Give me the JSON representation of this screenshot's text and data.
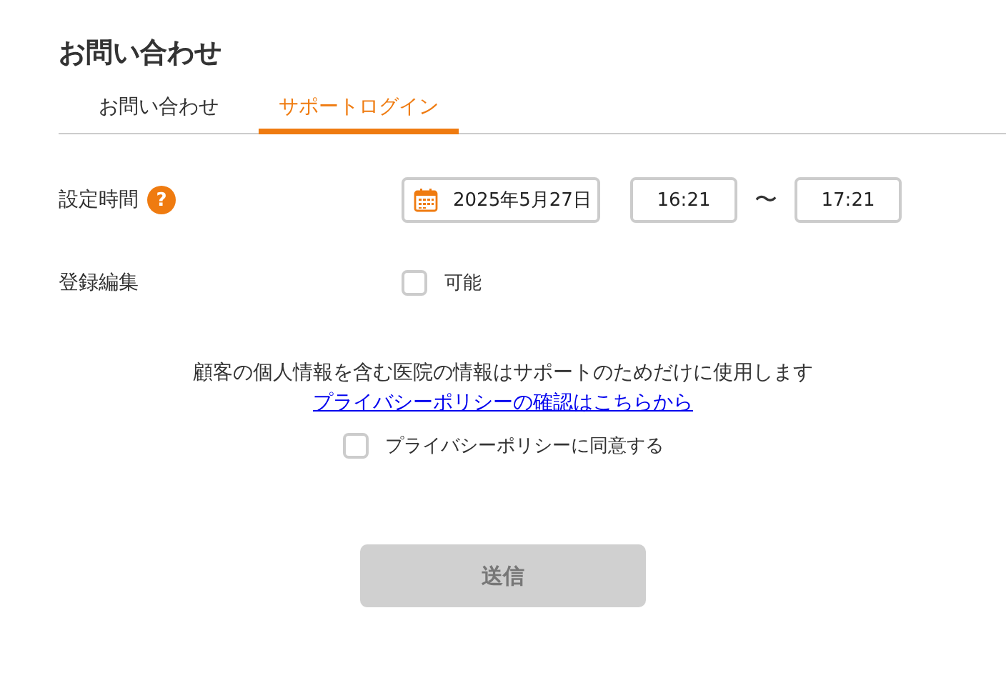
{
  "title": "お問い合わせ",
  "tabs": [
    {
      "label": "お問い合わせ",
      "selected": false
    },
    {
      "label": "サポートログイン",
      "selected": true
    }
  ],
  "rows": [
    {
      "kind": "datetime",
      "label": "設定時間",
      "help": "?",
      "date": "2025年5月27日",
      "start": "16:21",
      "separator": "〜",
      "end": "17:21"
    },
    {
      "kind": "checkbox",
      "label": "登録編集",
      "option": "可能",
      "checked": false
    }
  ],
  "notice": "顧客の個人情報を含む医院の情報はサポートのためだけに使用します",
  "policy_link": "プライバシーポリシーの確認はこちらから",
  "agree": {
    "label": "プライバシーポリシーに同意する",
    "checked": false
  },
  "submit": {
    "label": "送信",
    "disabled": true
  }
}
